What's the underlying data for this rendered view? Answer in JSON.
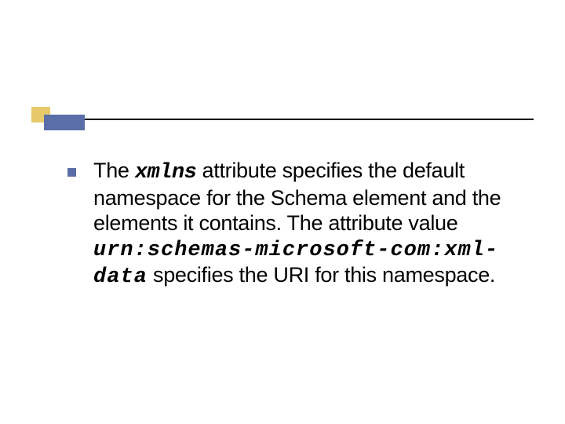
{
  "accent": {
    "yellow": "#e6c96a",
    "blue": "#5b6ea8"
  },
  "body": {
    "part1": "The ",
    "code1": "xmlns",
    "part2": " attribute specifies the default namespace for the Schema element and the elements it contains. The attribute value ",
    "code2": "urn:schemas-microsoft-com:xml-data",
    "part3": " specifies the URI for this namespace."
  }
}
